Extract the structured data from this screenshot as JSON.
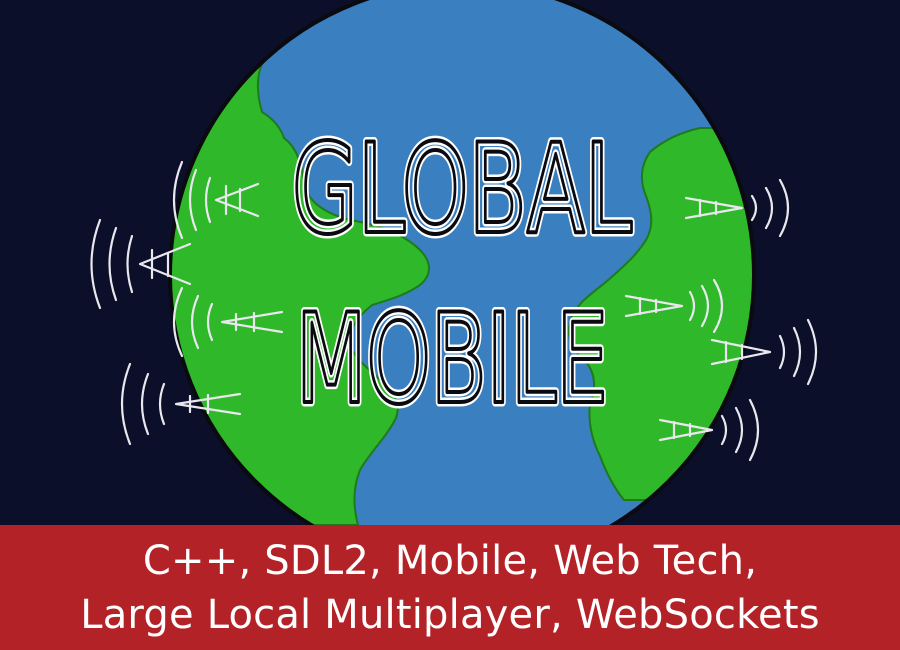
{
  "cover": {
    "title_line_1": "GLOBAL",
    "title_line_2": "MOBILE",
    "colors": {
      "background": "#0b0f29",
      "ocean": "#3a7fbf",
      "land": "#2fb82a",
      "outline": "#0a0a10",
      "banner": "#b32227",
      "text": "#ffffff"
    }
  },
  "banner": {
    "line_1": "C++, SDL2, Mobile, Web Tech,",
    "line_2": "Large Local Multiplayer, WebSockets"
  }
}
